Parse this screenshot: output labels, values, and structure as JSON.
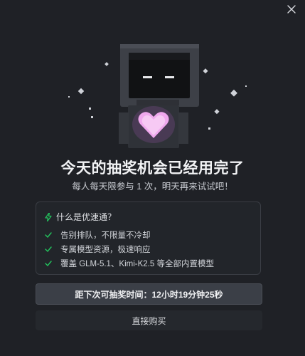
{
  "dialog": {
    "title": "今天的抽奖机会已经用完了",
    "subtitle": "每人每天限参与 1 次，明天再来试试吧！",
    "perks": {
      "heading": "什么是优速通？",
      "items": [
        "告别排队，不限量不冷却",
        "专属模型资源，极速响应",
        "覆盖 GLM-5.1、Kimi-K2.5 等全部内置模型"
      ]
    },
    "countdown_button": "距下次可抽奖时间：12小时19分钟25秒",
    "buy_button": "直接购买"
  },
  "colors": {
    "accent_green": "#22c55e",
    "heart_pink": "#f0a8ee",
    "background": "#1f2126"
  },
  "icons": {
    "close": "close-icon",
    "bolt": "lightning-icon",
    "check": "checkmark-icon",
    "mascot": "robot-mascot"
  }
}
